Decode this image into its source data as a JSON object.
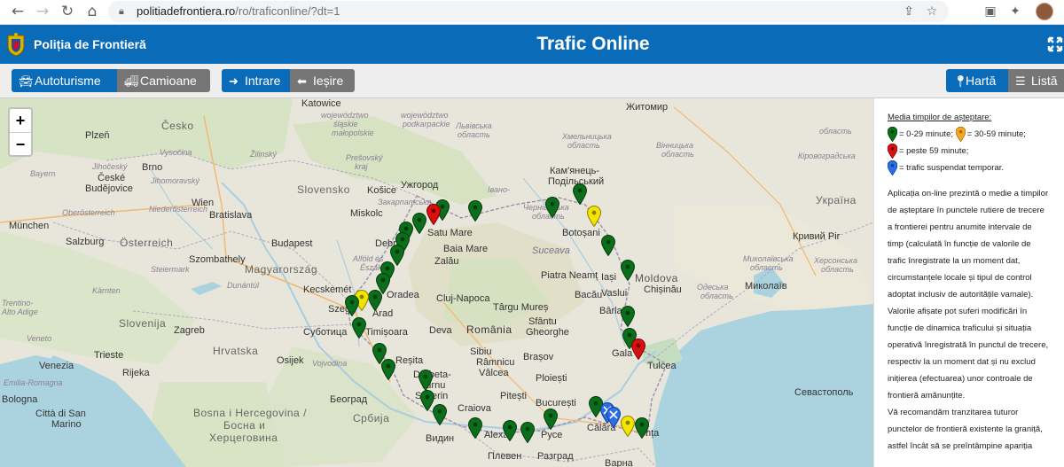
{
  "browser": {
    "url_host": "politiadefrontiera.ro",
    "url_path": "/ro/traficonline/?dt=1"
  },
  "header": {
    "brand": "Poliția de Frontieră",
    "title": "Trafic Online"
  },
  "toolbar": {
    "cars": "Autoturisme",
    "trucks": "Camioane",
    "entry": "Intrare",
    "exit": "Ieșire",
    "map": "Hartă",
    "list": "Listă"
  },
  "map": {
    "zoom_in": "+",
    "zoom_out": "−",
    "labels": {
      "katowice": "Katowice",
      "brno": "Brno",
      "plzen": "Plzeň",
      "cesko": "Česko",
      "ceske": "České",
      "budejovice": "Budějovice",
      "wien": "Wien",
      "bratislava": "Bratislava",
      "slovensko": "Slovensko",
      "kosice": "Košice",
      "uzhorod": "Ужгород",
      "miskolc": "Miskolc",
      "munchen": "München",
      "salzburg": "Salzburg",
      "osterreich": "Österreich",
      "szombathely": "Szombathely",
      "budapest": "Budapest",
      "magyarorszag": "Magyarország",
      "debrecen": "Debre",
      "kecskemet": "Kecskemét",
      "szeged": "Szeg",
      "oradea": "Oradea",
      "arad": "Arad",
      "timisoara": "Timișoara",
      "subotica": "Суботица",
      "osijek": "Osijek",
      "zagreb": "Zagreb",
      "slovenija": "Slovenija",
      "hrvatska": "Hrvatska",
      "trieste": "Trieste",
      "venezia": "Venezia",
      "rijeka": "Rijeka",
      "bologna": "Bologna",
      "sanmarino": "Città di San",
      "marino": "Marino",
      "bosna": "Bosna i Hercegovina /",
      "bosna2": "Босна и",
      "bosna3": "Херцеговина",
      "beograd": "Београд",
      "srbija": "Србија",
      "satumare": "Satu Mare",
      "baiamare": "Baia Mare",
      "zalau": "Zalău",
      "clujnapoca": "Cluj-Napoca",
      "romania": "România",
      "deva": "Deva",
      "sibiu": "Sibiu",
      "brasov": "Brașov",
      "ploiesti": "Ploiești",
      "pitesti": "Pitești",
      "ramnicu": "Râmnicu",
      "valcea": "Vâlcea",
      "targu": "Târgu Mureș",
      "sfantu": "Sfântu",
      "gheorghe": "Gheorghe",
      "bacau": "Bacău",
      "piatraneamt": "Piatra Neamț",
      "suceava": "Suceava",
      "botosani": "Botoșani",
      "iasi": "Iași",
      "vaslui": "Vaslui",
      "barlad": "Bârlad",
      "galati": "Gala",
      "tulcea": "Tulcea",
      "craiova": "Craiova",
      "bucuresti": "București",
      "calarasi": "Călăra",
      "constanta": "nța",
      "ruse": "Русе",
      "razgrad": "Разград",
      "pleven": "Плевен",
      "vidin": "Видин",
      "varna": "Варна",
      "resita": "Reșita",
      "drobeta": "Drobeta-",
      "turnu": "Turnu",
      "severin": "Severin",
      "alexandria": "Alexa",
      "moldova": "Moldova",
      "chisinau": "Chișinău",
      "kamianets": "Кам'янець-",
      "podilskyi": "Подільський",
      "ukraina": "Україна",
      "zhytomyr": "Житомир",
      "mykolaiv": "Миколаїв",
      "kryvyi": "Кривий Ріг",
      "sevastopol": "Севастополь",
      "lvivska": "Львівська",
      "khmelnytska": "Хмельницька",
      "vinnytska": "Вінницька",
      "chernivetska": "Чернівецька",
      "zakarpatska": "Закарпатська",
      "ivano": "Івано-",
      "odeska": "Одеська",
      "mykolaivska": "Миколаївська",
      "kirovohradska": "Кіровоградська",
      "kherson": "Херсонська",
      "oblast": "область",
      "wojewodztwo1": "województwo",
      "slaskie": "śląskie",
      "wojewodztwo2": "województwo",
      "podkarpackie": "podkarpackie",
      "malopolskie": "małopolskie",
      "presovsky": "Prešovský",
      "kraj": "kraj",
      "zilinsky": "Žilinský",
      "jihomoravsky": "Jihomoravský",
      "bayern": "Bayern",
      "oberosterreich": "Oberösterreich",
      "niederosterreich": "Niederösterreich",
      "steiermark": "Steiermark",
      "karnten": "Kärnten",
      "alfold": "Alföld és",
      "eszak": "Észak",
      "dunantul": "Dunántúl",
      "trentino": "Trentino-",
      "altoadige": "Alto Adige",
      "veneto": "Veneto",
      "vojvodina": "Vojvodina",
      "emilia": "Emilia-Romagna",
      "jihocesky": "Jihočeský",
      "vysocina": "Vysočina"
    }
  },
  "legend": {
    "title": "Media timpilor de așteptare",
    "green": "= 0-29 minute;",
    "yellow": "= 30-59 minute;",
    "red": "= peste 59 minute;",
    "blue": "= trafic suspendat temporar.",
    "lines": [
      "Aplicația on-line prezintă o medie a timpilor",
      "de așteptare în punctele rutiere de trecere",
      "a frontierei pentru anumite intervale de",
      "timp (calculată în funcție de valorile de",
      "trafic înregistrate la un moment dat,",
      "circumstanțele locale și tipul de control",
      "adoptat inclusiv de autoritățile vamale).",
      "Valorile afișate pot suferi modificări în",
      "funcție de dinamica traficului și situația",
      "operativă înregistrată în punctul de trecere,",
      "respectiv la un moment dat și nu exclud",
      "inițierea (efectuarea) unor controale de",
      "frontieră amănunțite.",
      "Vă recomandăm tranzitarea tuturor",
      "punctelor de frontieră existente la graniță,",
      "astfel încât să se preîntâmpine apariția"
    ]
  },
  "colors": {
    "header_blue": "#0a6cb8",
    "pin_green": "#0b6e1a",
    "pin_yellow": "#f2e600",
    "pin_red": "#d91010",
    "pin_blue": "#2a6ee8"
  }
}
